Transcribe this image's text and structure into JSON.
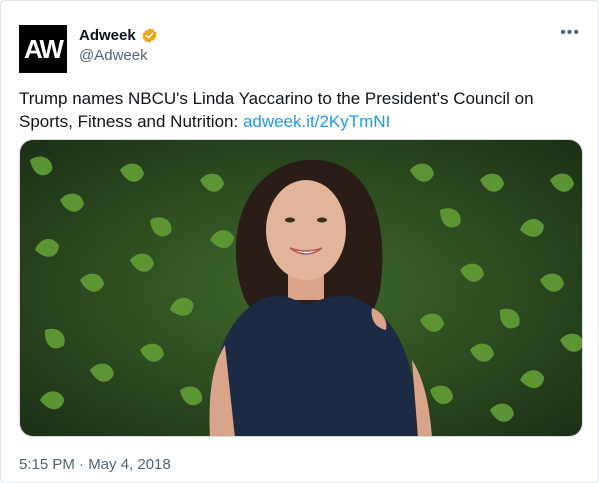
{
  "account": {
    "avatar_text": "AW",
    "name": "Adweek",
    "handle": "@Adweek",
    "verified_badge": "gold-verified-icon"
  },
  "menu": {
    "more_label": "•••"
  },
  "tweet": {
    "text": "Trump names NBCU's Linda Yaccarino to the President's Council on Sports, Fitness and Nutrition: ",
    "link_text": "adweek.it/2KyTmNI"
  },
  "media": {
    "description_icon": "photo-of-woman-in-front-of-green-plant-wall"
  },
  "footer": {
    "timestamp": "5:15 PM · May 4, 2018"
  },
  "colors": {
    "link": "#1d9bf0",
    "secondary_text": "#536471",
    "badge": "#e8a317"
  }
}
